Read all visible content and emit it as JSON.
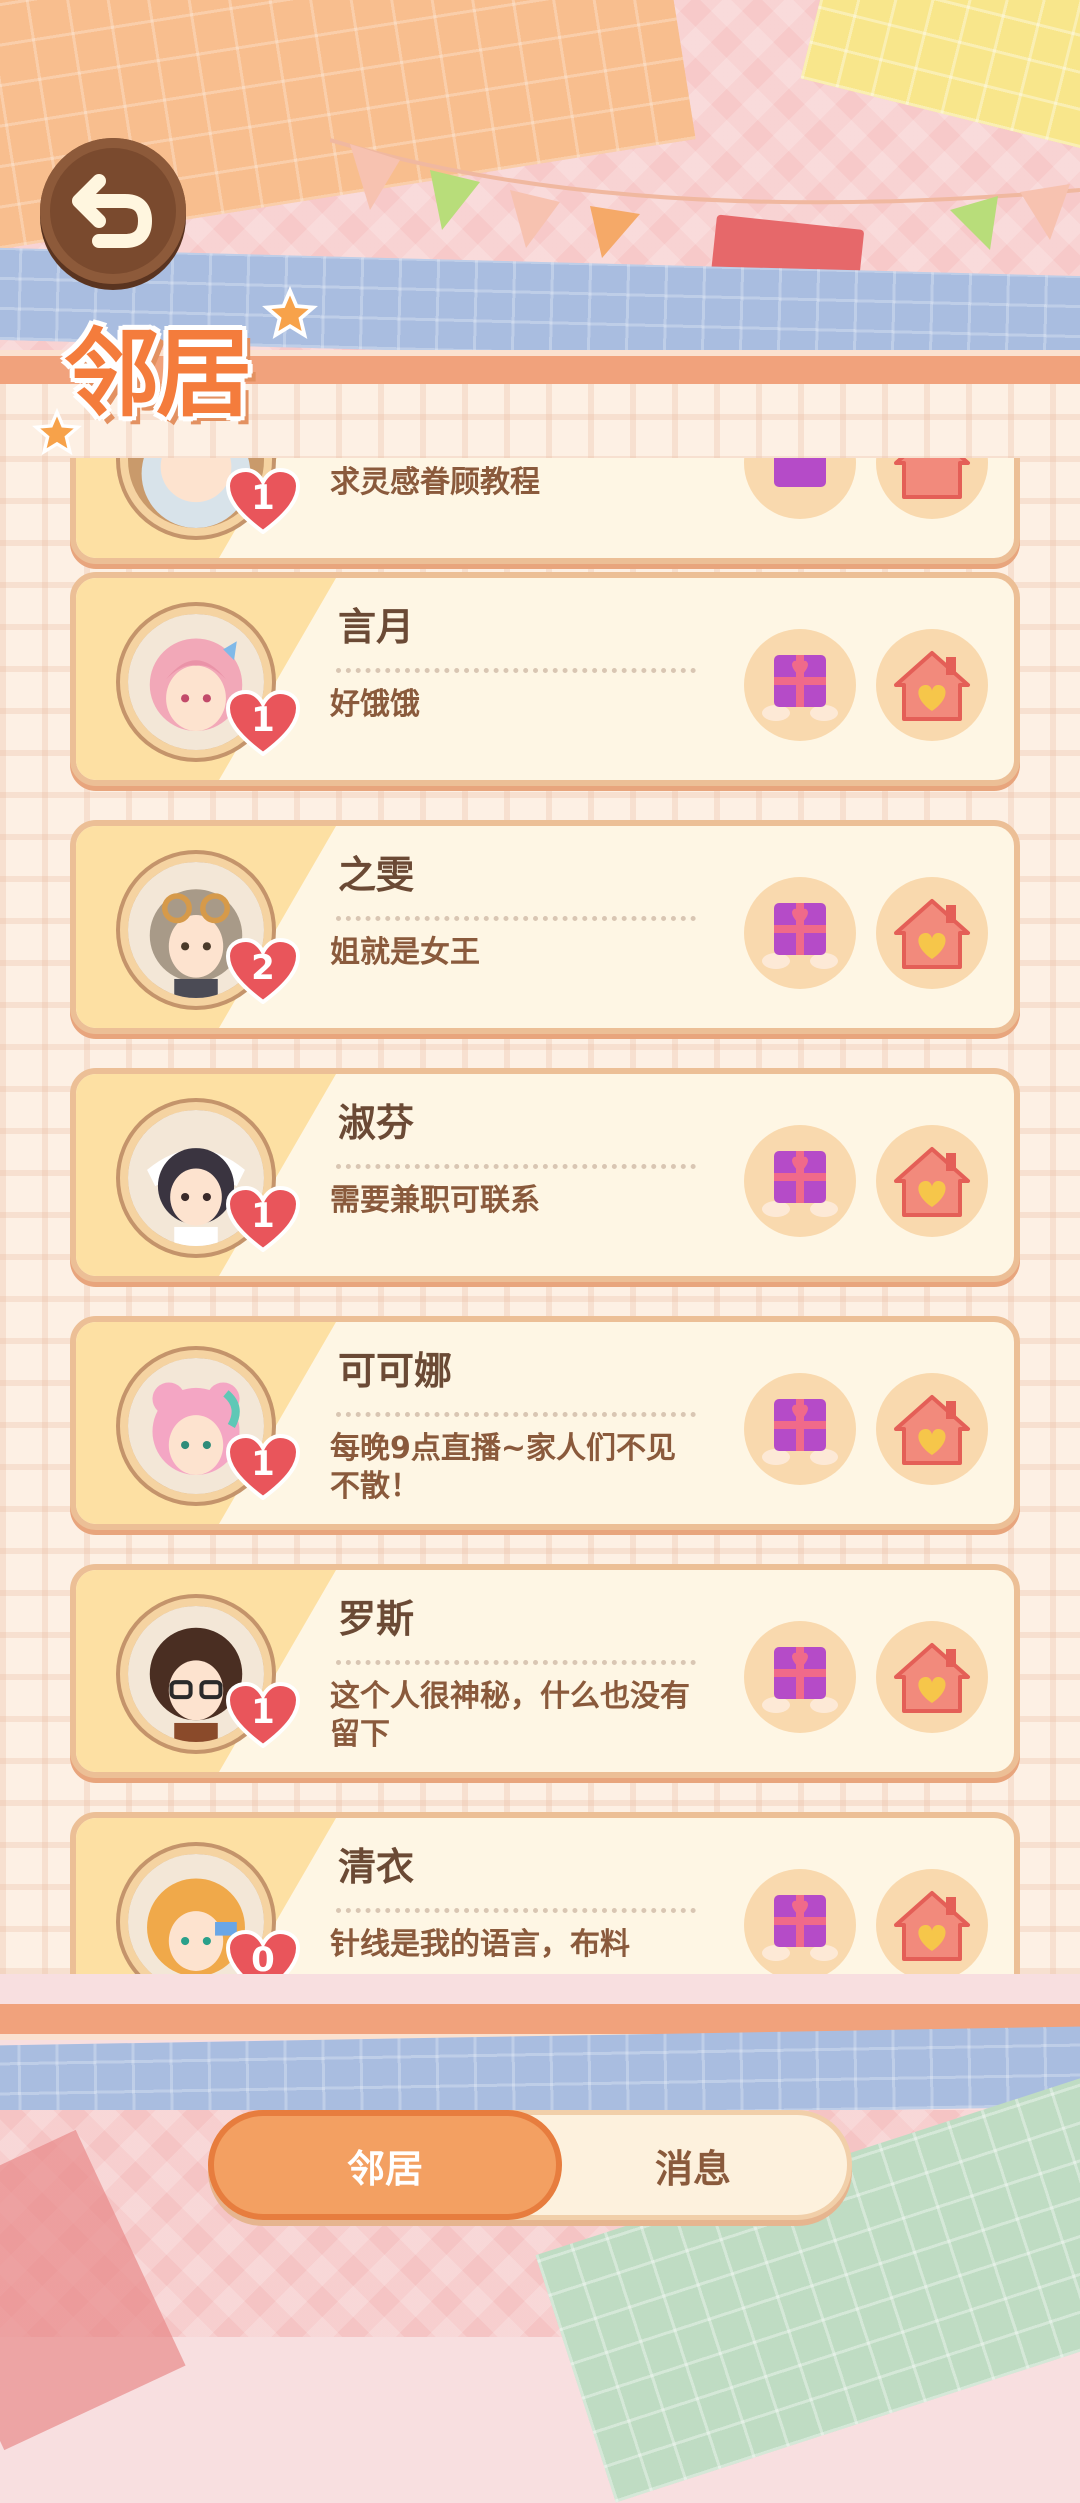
{
  "header": {
    "title": "邻居",
    "back_icon": "back-arrow-icon"
  },
  "neighbors": [
    {
      "name": "",
      "status": "求灵感眷顾教程",
      "hearts": "1"
    },
    {
      "name": "言月",
      "status": "好饿饿",
      "hearts": "1"
    },
    {
      "name": "之雯",
      "status": "姐就是女王",
      "hearts": "2"
    },
    {
      "name": "淑芬",
      "status": "需要兼职可联系",
      "hearts": "1"
    },
    {
      "name": "可可娜",
      "status": "每晚9点直播~家人们不见不散！",
      "hearts": "1"
    },
    {
      "name": "罗斯",
      "status": "这个人很神秘，什么也没有留下",
      "hearts": "1"
    },
    {
      "name": "清衣",
      "status": "针线是我的语言，布料",
      "hearts": "0"
    }
  ],
  "actions": {
    "gift_icon": "gift-box-icon",
    "visit_icon": "house-visit-icon"
  },
  "tabs": [
    {
      "label": "邻居",
      "active": true
    },
    {
      "label": "消息",
      "active": false
    }
  ],
  "colors": {
    "accent": "#f3a062",
    "heart": "#e9555b",
    "text_brown": "#6b4a35"
  }
}
